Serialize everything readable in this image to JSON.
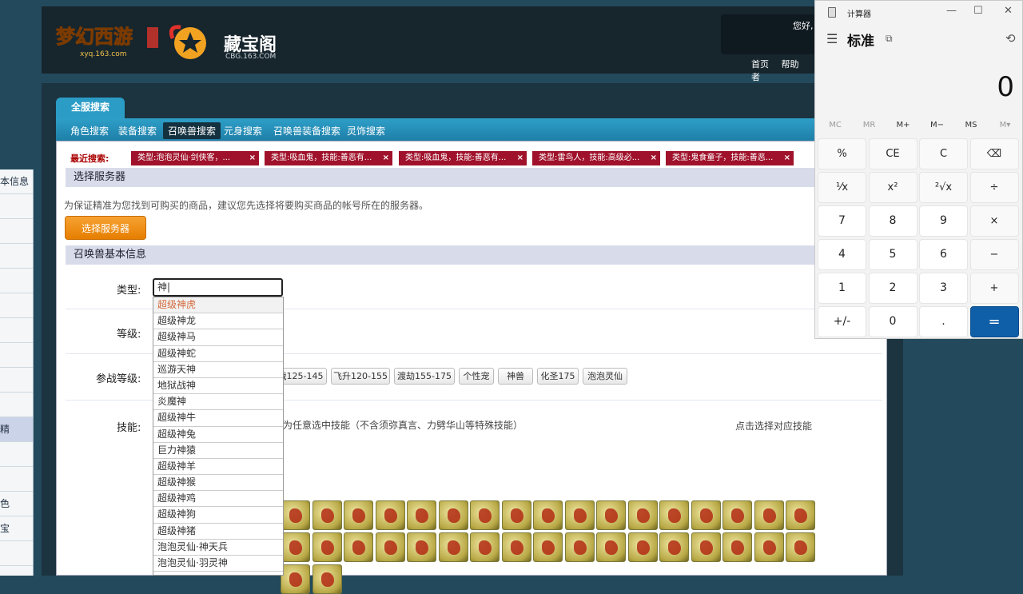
{
  "left_strip": {
    "items": [
      "本信息",
      "",
      "",
      "",
      "",
      "",
      "",
      "",
      "",
      "",
      "精",
      "",
      "",
      "色",
      "宝",
      ""
    ]
  },
  "header": {
    "game_logo": "xyq.163.com",
    "site_title": "藏宝阁",
    "site_sub": "CBG.163.COM",
    "greeting": "您好,",
    "nav": [
      "首页",
      "帮助",
      "者"
    ]
  },
  "tabs": {
    "main": "全服搜索",
    "sub": [
      "角色搜索",
      "装备搜索",
      "召唤兽搜索",
      "元身搜索",
      "召唤兽装备搜索",
      "灵饰搜索"
    ],
    "active_sub": "召唤兽搜索"
  },
  "recent": {
    "label": "最近搜索:",
    "items": [
      "类型:泡泡灵仙·剑侠客，...",
      "类型:吸血鬼，技能:善恶有...",
      "类型:吸血鬼，技能:善恶有...",
      "类型:雷鸟人，技能:高级必...",
      "类型:鬼食童子，技能:善恶..."
    ],
    "close": "×"
  },
  "server": {
    "heading": "选择服务器",
    "tip": "为保证精准为您找到可购买的商品，建议您先选择将要购买商品的帐号所在的服务器。",
    "button": "选择服务器"
  },
  "basic": {
    "heading": "召唤兽基本信息",
    "type_label": "类型:",
    "type_value": "神|",
    "level_label": "等级:",
    "battle_label": "参战等级:",
    "skill_label": "技能:",
    "skill_note": "为任意选中技能（不含须弥真言、力劈华山等特殊技能）",
    "skill_pick": "点击选择对应技能"
  },
  "dropdown": [
    "超级神虎",
    "超级神龙",
    "超级神马",
    "超级神蛇",
    "巡游天神",
    "地狱战神",
    "炎魔神",
    "超级神牛",
    "超级神兔",
    "巨力神猿",
    "超级神羊",
    "超级神猴",
    "超级神鸡",
    "超级神狗",
    "超级神猪",
    "泡泡灵仙·神天兵",
    "泡泡灵仙·羽灵神"
  ],
  "battle_levels": [
    "战125-145",
    "飞升120-155",
    "渡劫155-175",
    "个性宠",
    "神兽",
    "化圣175",
    "泡泡灵仙"
  ],
  "skill_icons": [
    "skill-icon"
  ],
  "calculator": {
    "title": "计算器",
    "mode": "标准",
    "display": "0",
    "memory": [
      "MC",
      "MR",
      "M+",
      "M−",
      "MS",
      "M▾"
    ],
    "keys": [
      [
        "%",
        "CE",
        "C",
        "⌫"
      ],
      [
        "¹⁄x",
        "x²",
        "²√x",
        "÷"
      ],
      [
        "7",
        "8",
        "9",
        "×"
      ],
      [
        "4",
        "5",
        "6",
        "−"
      ],
      [
        "1",
        "2",
        "3",
        "+"
      ],
      [
        "+/-",
        "0",
        ".",
        "="
      ]
    ]
  }
}
